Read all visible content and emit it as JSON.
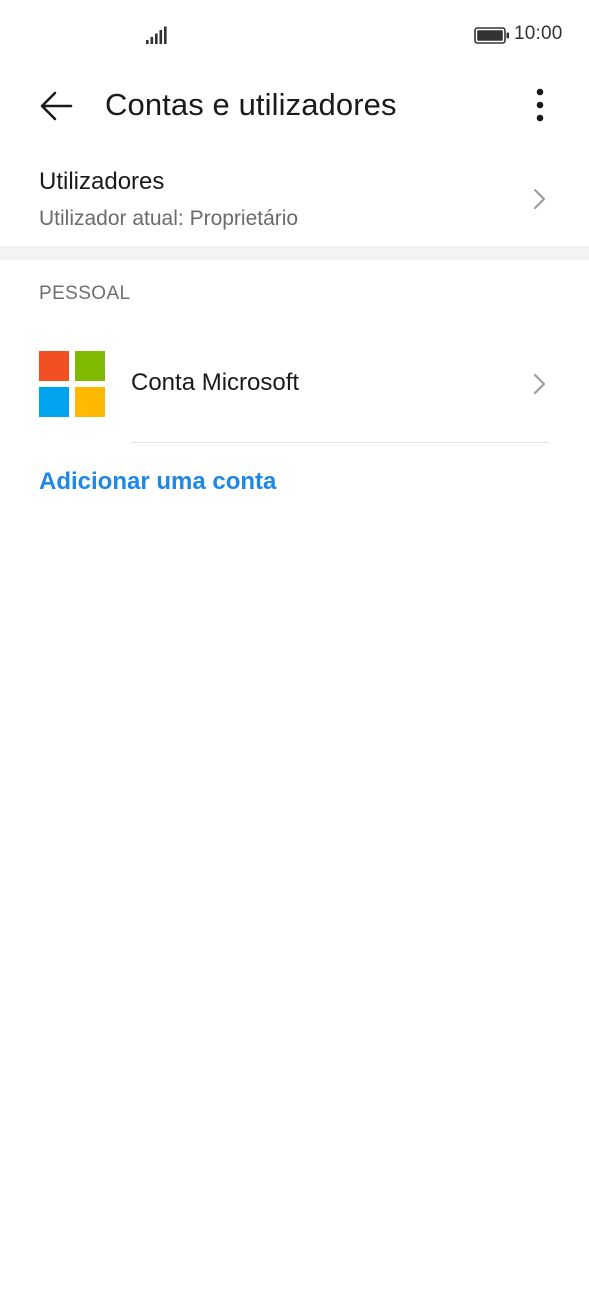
{
  "status_bar": {
    "time": "10:00",
    "signal_icon": "signal-bars-icon",
    "battery_icon": "battery-full-icon"
  },
  "app_bar": {
    "title": "Contas e utilizadores",
    "back_icon": "back-arrow-icon",
    "more_icon": "more-vertical-icon"
  },
  "users": {
    "title": "Utilizadores",
    "subtitle": "Utilizador atual: Proprietário",
    "chevron_icon": "chevron-right-icon"
  },
  "personal": {
    "header": "PESSOAL",
    "accounts": [
      {
        "label": "Conta Microsoft",
        "icon": "microsoft-logo-icon",
        "logo_colors": [
          "#f25022",
          "#7fba00",
          "#00a4ef",
          "#ffb900"
        ]
      }
    ]
  },
  "add_account": {
    "label": "Adicionar uma conta"
  },
  "colors": {
    "accent": "#1f87e5",
    "background": "#ffffff",
    "divider": "#f3f3f3"
  }
}
